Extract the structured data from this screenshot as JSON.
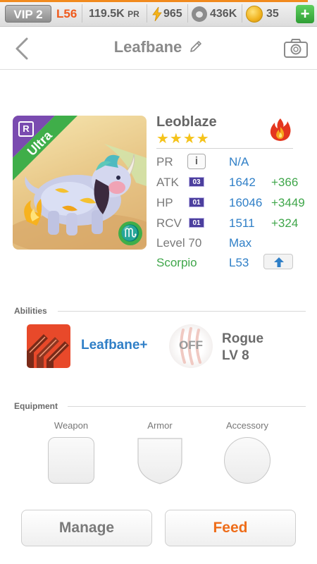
{
  "statusbar": {
    "vip": "VIP 2",
    "level": "L56",
    "power": "119.5K",
    "power_unit": "PR",
    "energy": "965",
    "food": "436K",
    "gems": "35",
    "add": "+",
    "xp_progress": 0.97
  },
  "header": {
    "title": "Leafbane"
  },
  "monster": {
    "name": "Leoblaze",
    "stars": "★★★★",
    "rarity": "Ultra",
    "rarity_badge": "R",
    "zodiac_symbol": "♏",
    "stats": {
      "pr_label": "PR",
      "pr_info": "i",
      "pr_value": "N/A",
      "atk_label": "ATK",
      "atk_level": "03",
      "atk_value": "1642",
      "atk_bonus": "+366",
      "hp_label": "HP",
      "hp_level": "01",
      "hp_value": "16046",
      "hp_bonus": "+3449",
      "rcv_label": "RCV",
      "rcv_level": "01",
      "rcv_value": "1511",
      "rcv_bonus": "+324",
      "level_label": "Level 70",
      "level_value": "Max",
      "zodiac_label": "Scorpio",
      "zodiac_value": "L53"
    }
  },
  "abilities": {
    "section_title": "Abilities",
    "ability_name": "Leafbane+",
    "off_label": "OFF",
    "skill_name": "Rogue",
    "skill_level": "LV 8"
  },
  "equipment": {
    "section_title": "Equipment",
    "weapon": "Weapon",
    "armor": "Armor",
    "accessory": "Accessory"
  },
  "actions": {
    "manage": "Manage",
    "feed": "Feed"
  },
  "colors": {
    "accent_orange": "#ee6d1a",
    "link_blue": "#2f7fc7",
    "bonus_green": "#3fa64a",
    "ultra_purple": "#7a4bb0",
    "ultra_green": "#3fae49"
  }
}
